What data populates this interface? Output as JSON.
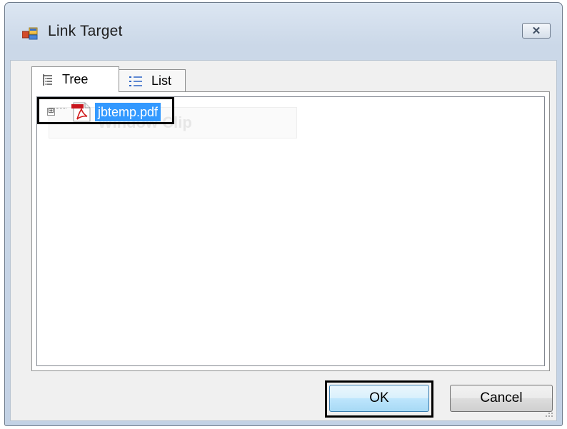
{
  "window": {
    "title": "Link Target",
    "close_glyph": "✕",
    "icon": "link-target-app-icon"
  },
  "tabs": [
    {
      "label": "Tree",
      "icon": "tree-view-icon",
      "active": true
    },
    {
      "label": "List",
      "icon": "list-view-icon",
      "active": false
    }
  ],
  "tree": {
    "nodes": [
      {
        "label": "jbtemp.pdf",
        "icon": "pdf-file-icon",
        "expander": "⊞",
        "selected": true
      }
    ],
    "ghost_text": "Window Clip"
  },
  "buttons": {
    "ok_label": "OK",
    "cancel_label": "Cancel"
  },
  "colors": {
    "selection": "#3399ff",
    "title_bar": "#cbd8e8",
    "client_background": "#f0f0f0"
  }
}
